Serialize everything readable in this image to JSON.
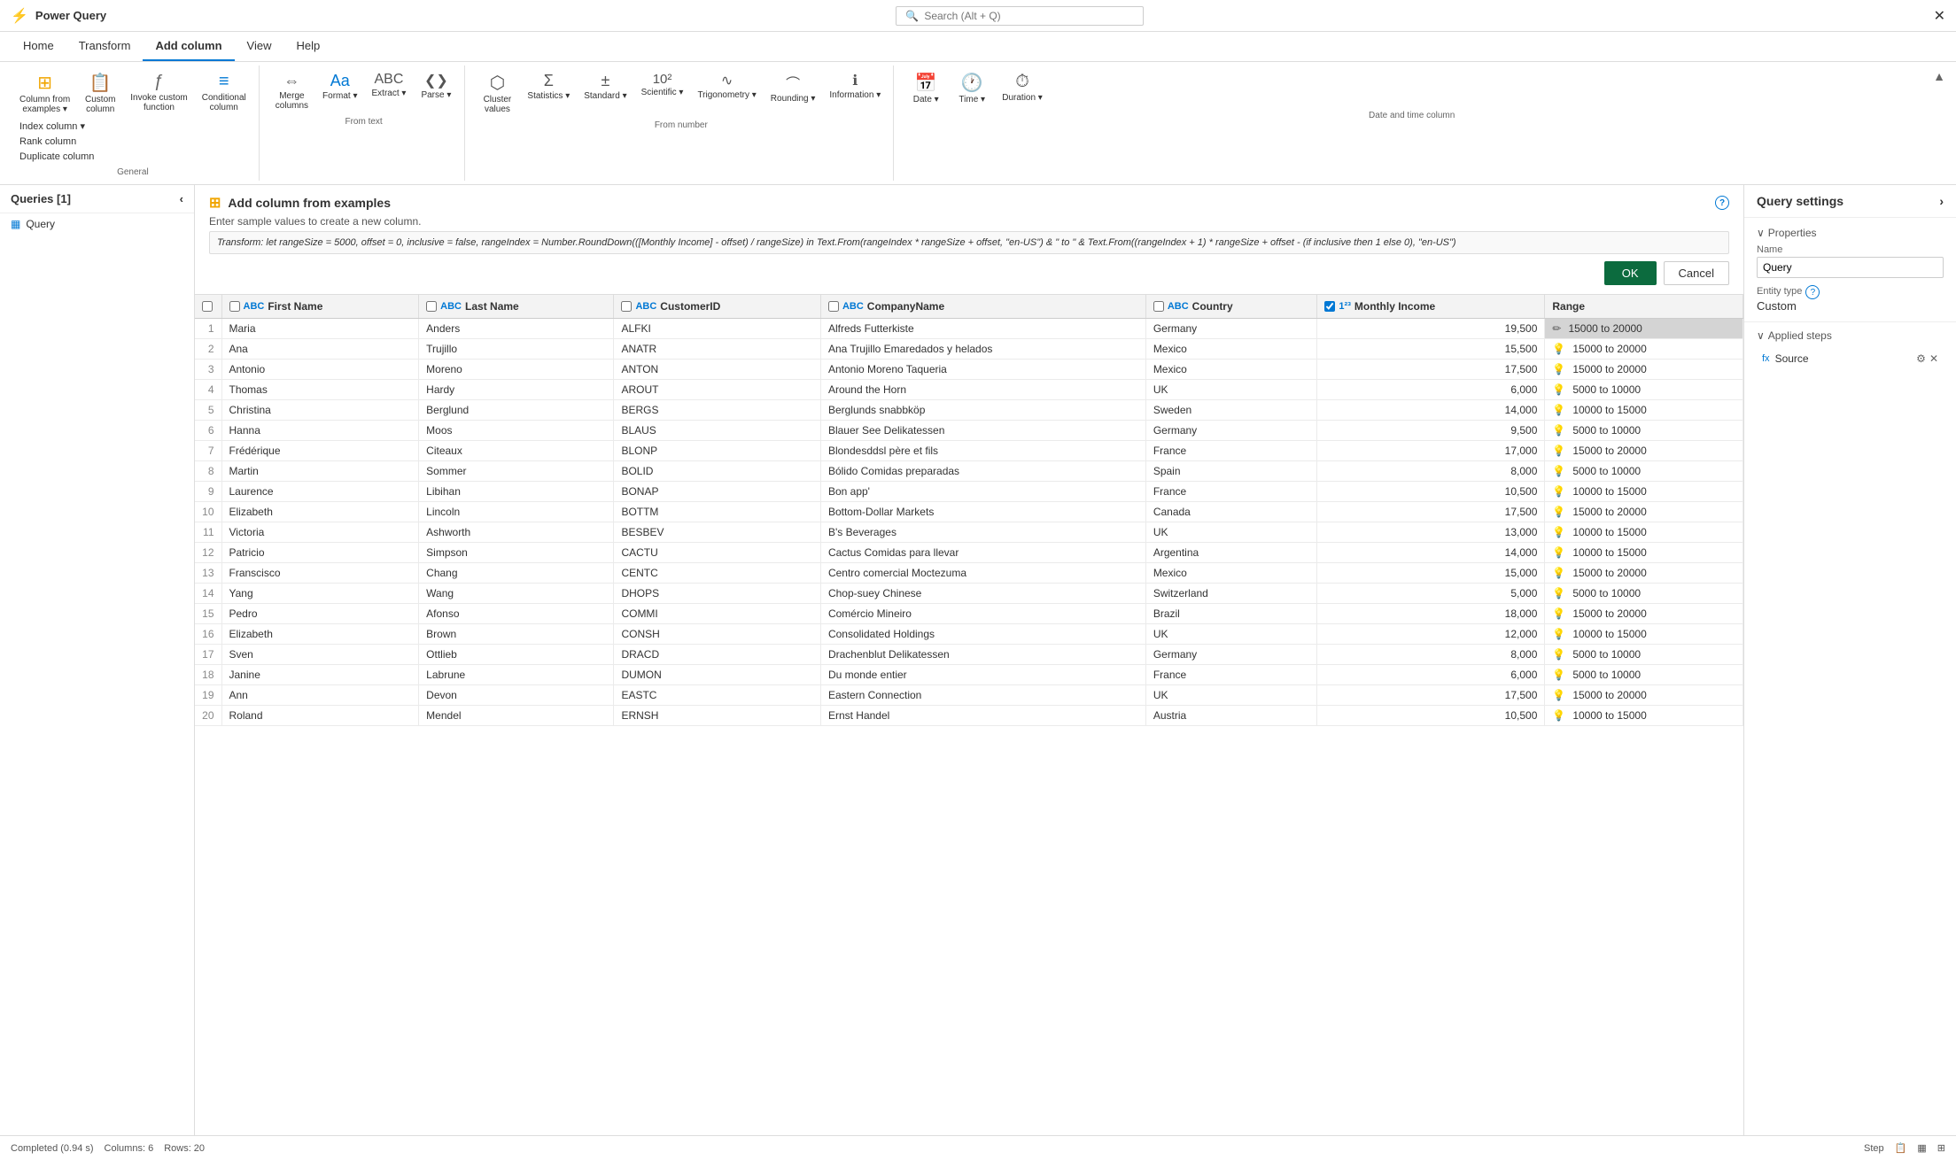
{
  "app": {
    "title": "Power Query"
  },
  "search": {
    "placeholder": "Search (Alt + Q)"
  },
  "close_label": "✕",
  "ribbon": {
    "tabs": [
      "Home",
      "Transform",
      "Add column",
      "View",
      "Help"
    ],
    "active_tab": "Add column",
    "groups": [
      {
        "label": "General",
        "buttons": [
          {
            "id": "col-from-examples",
            "label": "Column from\nexamples",
            "icon": "⊞",
            "dropdown": true
          },
          {
            "id": "custom-col",
            "label": "Custom\ncolumn",
            "icon": "📋"
          },
          {
            "id": "invoke-custom",
            "label": "Invoke custom\nfunction",
            "icon": "ƒ"
          },
          {
            "id": "conditional-col",
            "label": "Conditional\ncolumn",
            "icon": "≡"
          }
        ],
        "small_buttons": [
          {
            "id": "index-col",
            "label": "Index column",
            "dropdown": true
          },
          {
            "id": "rank-col",
            "label": "Rank column"
          },
          {
            "id": "duplicate-col",
            "label": "Duplicate column"
          }
        ]
      },
      {
        "label": "From text",
        "buttons": [
          {
            "id": "format-btn",
            "label": "Format",
            "icon": "Aa",
            "dropdown": true
          },
          {
            "id": "extract-btn",
            "label": "Extract",
            "icon": "ABC",
            "dropdown": true
          },
          {
            "id": "parse-btn",
            "label": "Parse",
            "icon": "❮❯",
            "dropdown": true
          }
        ],
        "small_buttons": [
          {
            "id": "merge-cols",
            "label": "Merge columns"
          }
        ]
      },
      {
        "label": "From number",
        "buttons": [
          {
            "id": "statistics-btn",
            "label": "Statistics",
            "icon": "Σ",
            "dropdown": true
          },
          {
            "id": "standard-btn",
            "label": "Standard",
            "icon": "±",
            "dropdown": true
          },
          {
            "id": "scientific-btn",
            "label": "Scientific",
            "icon": "10²",
            "dropdown": true
          },
          {
            "id": "trigonometry-btn",
            "label": "Trigonometry",
            "icon": "∿",
            "dropdown": true
          },
          {
            "id": "rounding-btn",
            "label": "Rounding",
            "icon": "⌒",
            "dropdown": true
          },
          {
            "id": "information-btn",
            "label": "Information",
            "icon": "ℹ",
            "dropdown": true
          }
        ],
        "small_buttons": [
          {
            "id": "cluster-values",
            "label": "Cluster\nvalues",
            "icon": "⬡"
          }
        ]
      },
      {
        "label": "Date and time column",
        "buttons": [
          {
            "id": "date-btn",
            "label": "Date",
            "icon": "📅",
            "dropdown": true
          },
          {
            "id": "time-btn",
            "label": "Time",
            "icon": "🕐",
            "dropdown": true
          },
          {
            "id": "duration-btn",
            "label": "Duration",
            "icon": "⏱",
            "dropdown": true
          }
        ]
      }
    ]
  },
  "queries_panel": {
    "title": "Queries [1]",
    "items": [
      {
        "label": "Query",
        "icon": "table"
      }
    ]
  },
  "add_col_panel": {
    "title": "Add column from examples",
    "subtitle": "Enter sample values to create a new column.",
    "transform_label": "Transform:",
    "transform_text": "let rangeSize = 5000, offset = 0, inclusive = false, rangeIndex = Number.RoundDown(([Monthly Income] - offset) / rangeSize) in Text.From(rangeIndex * rangeSize + offset, \"en-US\") & \" to \" & Text.From((rangeIndex + 1) * rangeSize + offset - (if inclusive then 1 else 0), \"en-US\")",
    "ok_label": "OK",
    "cancel_label": "Cancel",
    "help_icon": "?"
  },
  "table": {
    "columns": [
      {
        "id": "row-num",
        "label": ""
      },
      {
        "id": "first-name",
        "label": "First Name",
        "type": "ABC",
        "checked": false
      },
      {
        "id": "last-name",
        "label": "Last Name",
        "type": "ABC",
        "checked": false
      },
      {
        "id": "customer-id",
        "label": "CustomerID",
        "type": "ABC",
        "checked": false
      },
      {
        "id": "company-name",
        "label": "CompanyName",
        "type": "ABC",
        "checked": false
      },
      {
        "id": "country",
        "label": "Country",
        "type": "ABC",
        "checked": false
      },
      {
        "id": "monthly-income",
        "label": "Monthly Income",
        "type": "123",
        "checked": true
      },
      {
        "id": "range",
        "label": "Range",
        "type": null,
        "checked": null
      }
    ],
    "rows": [
      {
        "num": 1,
        "first": "Maria",
        "last": "Anders",
        "cid": "ALFKI",
        "company": "Alfreds Futterkiste",
        "country": "Germany",
        "income": "19500",
        "range": "15000 to 20000",
        "range_edit": true
      },
      {
        "num": 2,
        "first": "Ana",
        "last": "Trujillo",
        "cid": "ANATR",
        "company": "Ana Trujillo Emaredados y helados",
        "country": "Mexico",
        "income": "15500",
        "range": "15000 to 20000",
        "range_edit": false
      },
      {
        "num": 3,
        "first": "Antonio",
        "last": "Moreno",
        "cid": "ANTON",
        "company": "Antonio Moreno Taqueria",
        "country": "Mexico",
        "income": "17500",
        "range": "15000 to 20000",
        "range_edit": false
      },
      {
        "num": 4,
        "first": "Thomas",
        "last": "Hardy",
        "cid": "AROUT",
        "company": "Around the Horn",
        "country": "UK",
        "income": "6000",
        "range": "5000 to 10000",
        "range_edit": false
      },
      {
        "num": 5,
        "first": "Christina",
        "last": "Berglund",
        "cid": "BERGS",
        "company": "Berglunds snabbköp",
        "country": "Sweden",
        "income": "14000",
        "range": "10000 to 15000",
        "range_edit": false
      },
      {
        "num": 6,
        "first": "Hanna",
        "last": "Moos",
        "cid": "BLAUS",
        "company": "Blauer See Delikatessen",
        "country": "Germany",
        "income": "9500",
        "range": "5000 to 10000",
        "range_edit": false
      },
      {
        "num": 7,
        "first": "Frédérique",
        "last": "Citeaux",
        "cid": "BLONP",
        "company": "Blondesddsl père et fils",
        "country": "France",
        "income": "17000",
        "range": "15000 to 20000",
        "range_edit": false
      },
      {
        "num": 8,
        "first": "Martin",
        "last": "Sommer",
        "cid": "BOLID",
        "company": "Bólido Comidas preparadas",
        "country": "Spain",
        "income": "8000",
        "range": "5000 to 10000",
        "range_edit": false
      },
      {
        "num": 9,
        "first": "Laurence",
        "last": "Libihan",
        "cid": "BONAP",
        "company": "Bon app'",
        "country": "France",
        "income": "10500",
        "range": "10000 to 15000",
        "range_edit": false
      },
      {
        "num": 10,
        "first": "Elizabeth",
        "last": "Lincoln",
        "cid": "BOTTM",
        "company": "Bottom-Dollar Markets",
        "country": "Canada",
        "income": "17500",
        "range": "15000 to 20000",
        "range_edit": false
      },
      {
        "num": 11,
        "first": "Victoria",
        "last": "Ashworth",
        "cid": "BESBEV",
        "company": "B's Beverages",
        "country": "UK",
        "income": "13000",
        "range": "10000 to 15000",
        "range_edit": false
      },
      {
        "num": 12,
        "first": "Patricio",
        "last": "Simpson",
        "cid": "CACTU",
        "company": "Cactus Comidas para llevar",
        "country": "Argentina",
        "income": "14000",
        "range": "10000 to 15000",
        "range_edit": false
      },
      {
        "num": 13,
        "first": "Franscisco",
        "last": "Chang",
        "cid": "CENTC",
        "company": "Centro comercial Moctezuma",
        "country": "Mexico",
        "income": "15000",
        "range": "15000 to 20000",
        "range_edit": false
      },
      {
        "num": 14,
        "first": "Yang",
        "last": "Wang",
        "cid": "DHOPS",
        "company": "Chop-suey Chinese",
        "country": "Switzerland",
        "income": "5000",
        "range": "5000 to 10000",
        "range_edit": false
      },
      {
        "num": 15,
        "first": "Pedro",
        "last": "Afonso",
        "cid": "COMMI",
        "company": "Comércio Mineiro",
        "country": "Brazil",
        "income": "18000",
        "range": "15000 to 20000",
        "range_edit": false
      },
      {
        "num": 16,
        "first": "Elizabeth",
        "last": "Brown",
        "cid": "CONSH",
        "company": "Consolidated Holdings",
        "country": "UK",
        "income": "12000",
        "range": "10000 to 15000",
        "range_edit": false
      },
      {
        "num": 17,
        "first": "Sven",
        "last": "Ottlieb",
        "cid": "DRACD",
        "company": "Drachenblut Delikatessen",
        "country": "Germany",
        "income": "8000",
        "range": "5000 to 10000",
        "range_edit": false
      },
      {
        "num": 18,
        "first": "Janine",
        "last": "Labrune",
        "cid": "DUMON",
        "company": "Du monde entier",
        "country": "France",
        "income": "6000",
        "range": "5000 to 10000",
        "range_edit": false
      },
      {
        "num": 19,
        "first": "Ann",
        "last": "Devon",
        "cid": "EASTC",
        "company": "Eastern Connection",
        "country": "UK",
        "income": "17500",
        "range": "15000 to 20000",
        "range_edit": false
      },
      {
        "num": 20,
        "first": "Roland",
        "last": "Mendel",
        "cid": "ERNSH",
        "company": "Ernst Handel",
        "country": "Austria",
        "income": "10500",
        "range": "10000 to 15000",
        "range_edit": false
      }
    ]
  },
  "query_settings": {
    "title": "Query settings",
    "expand_icon": "›",
    "properties_title": "Properties",
    "name_label": "Name",
    "name_value": "Query",
    "entity_type_label": "Entity type",
    "entity_type_help": "?",
    "entity_type_value": "Custom",
    "applied_steps_title": "Applied steps",
    "steps": [
      {
        "label": "Source",
        "fx": true
      }
    ]
  },
  "status_bar": {
    "status": "Completed (0.94 s)",
    "columns": "Columns: 6",
    "rows": "Rows: 20",
    "step_label": "Step",
    "icons": [
      "step",
      "table",
      "grid"
    ]
  }
}
